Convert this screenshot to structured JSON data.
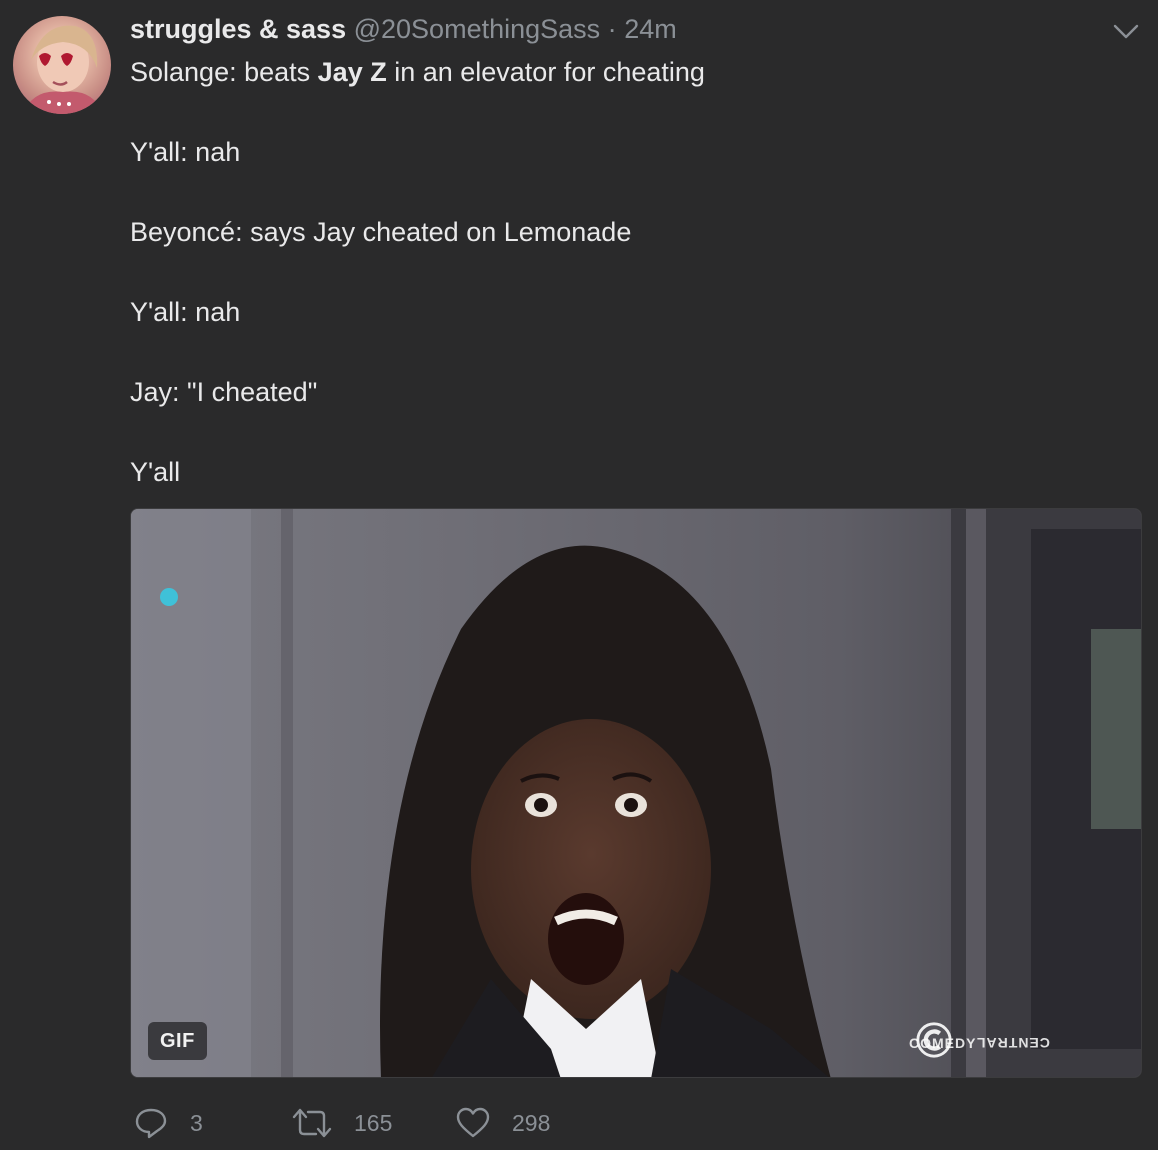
{
  "tweet": {
    "author_name": "struggles & sass",
    "handle": "@20SomethingSass",
    "separator": "·",
    "time": "24m",
    "lines": {
      "l1_pre": "Solange: beats ",
      "l1_bold": "Jay Z",
      "l1_post": " in an elevator for cheating",
      "l2": "Y'all: nah",
      "l3": "Beyoncé: says Jay cheated on Lemonade",
      "l4": "Y'all: nah",
      "l5": "Jay: \"I cheated\"",
      "l6": "Y'all"
    }
  },
  "media": {
    "badge": "GIF",
    "watermark_left": "COMEDY",
    "watermark_right": "CENTRAL"
  },
  "actions": {
    "reply_count": "3",
    "retweet_count": "165",
    "like_count": "298"
  },
  "colors": {
    "background": "#2a2a2b",
    "text": "#e9e9ea",
    "muted": "#8b9096"
  },
  "icons": [
    "chevron-down-icon",
    "reply-icon",
    "retweet-icon",
    "heart-icon",
    "comedy-central-logo"
  ]
}
